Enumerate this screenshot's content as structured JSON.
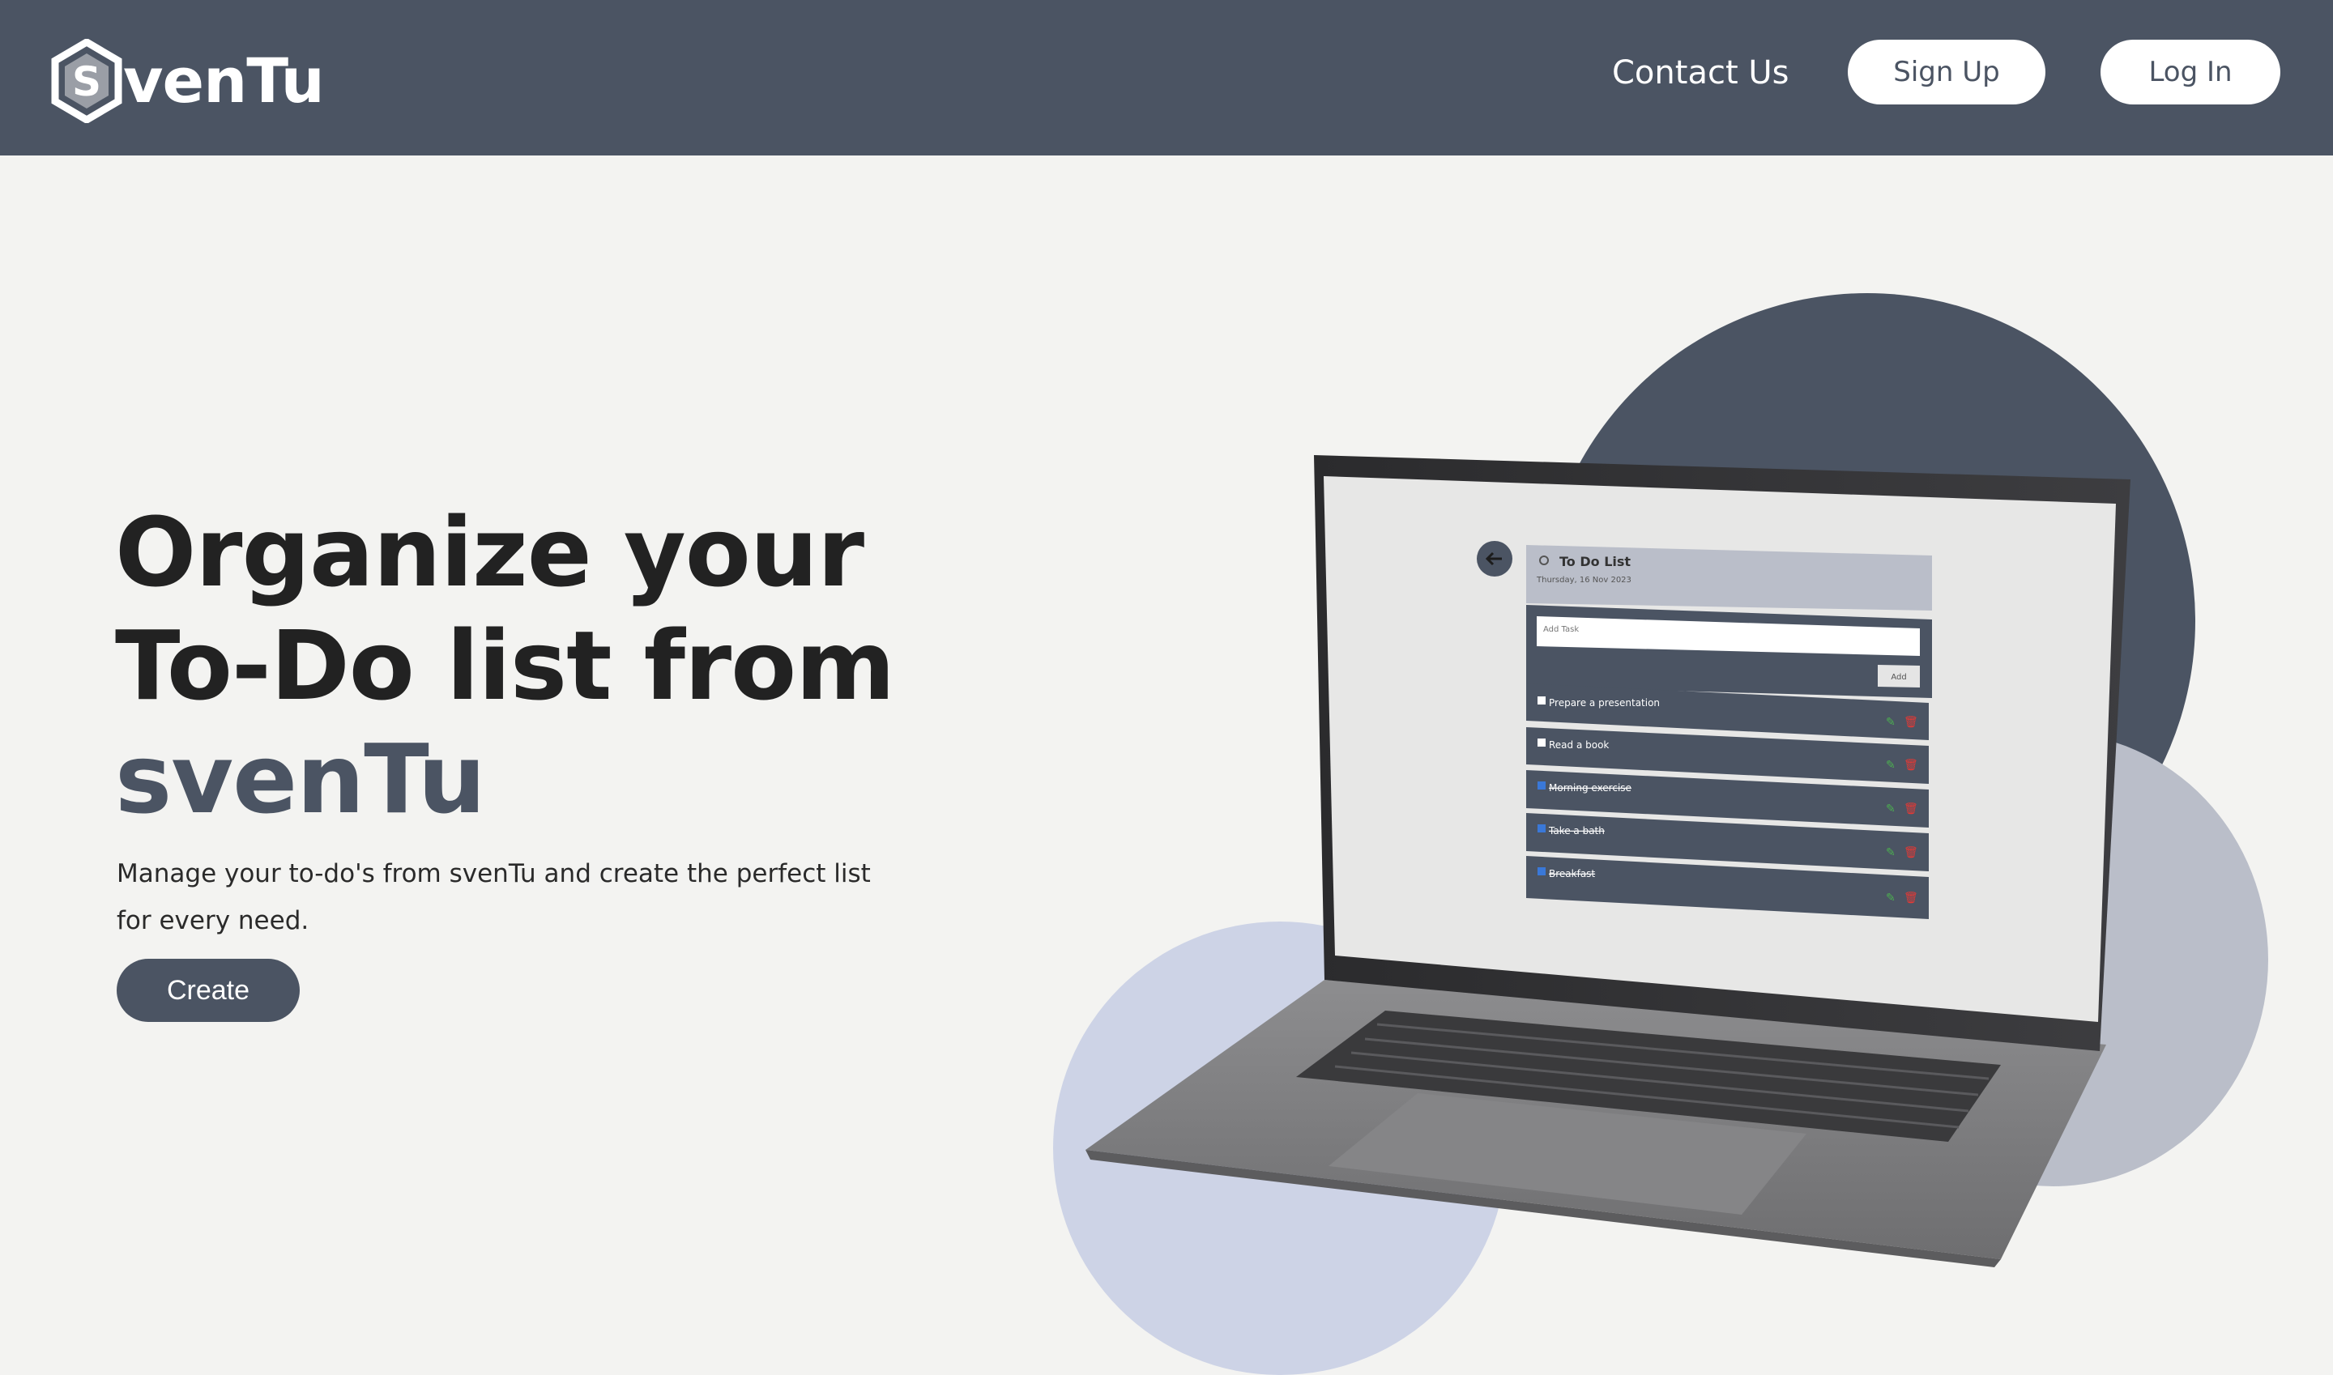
{
  "header": {
    "logo_letter": "S",
    "logo_text": "venTu",
    "contact_label": "Contact Us",
    "signup_label": "Sign Up",
    "login_label": "Log In"
  },
  "hero": {
    "title_line1": "Organize your",
    "title_line2": "To-Do list from",
    "title_brand": "svenTu",
    "subtitle": "Manage your to-do's from svenTu and create the perfect list for every need.",
    "cta_label": "Create"
  },
  "laptop_screen": {
    "app_title": "To Do List",
    "date": "Thursday, 16 Nov 2023",
    "add_task_placeholder": "Add Task",
    "add_button": "Add",
    "tasks": [
      {
        "label": "Prepare a presentation",
        "done": false
      },
      {
        "label": "Read a book",
        "done": false
      },
      {
        "label": "Morning exercise",
        "done": true
      },
      {
        "label": "Take a bath",
        "done": true
      },
      {
        "label": "Breakfast",
        "done": true
      }
    ]
  },
  "colors": {
    "brand_dark": "#4b5463",
    "background": "#f3f3f1",
    "accent_grey": "#babec9",
    "accent_blue": "#cdd3e6",
    "white": "#ffffff"
  },
  "icons": [
    "logo-hexagon-icon",
    "back-arrow-icon",
    "sun-icon",
    "edit-icon",
    "delete-icon",
    "checkbox-icon"
  ]
}
